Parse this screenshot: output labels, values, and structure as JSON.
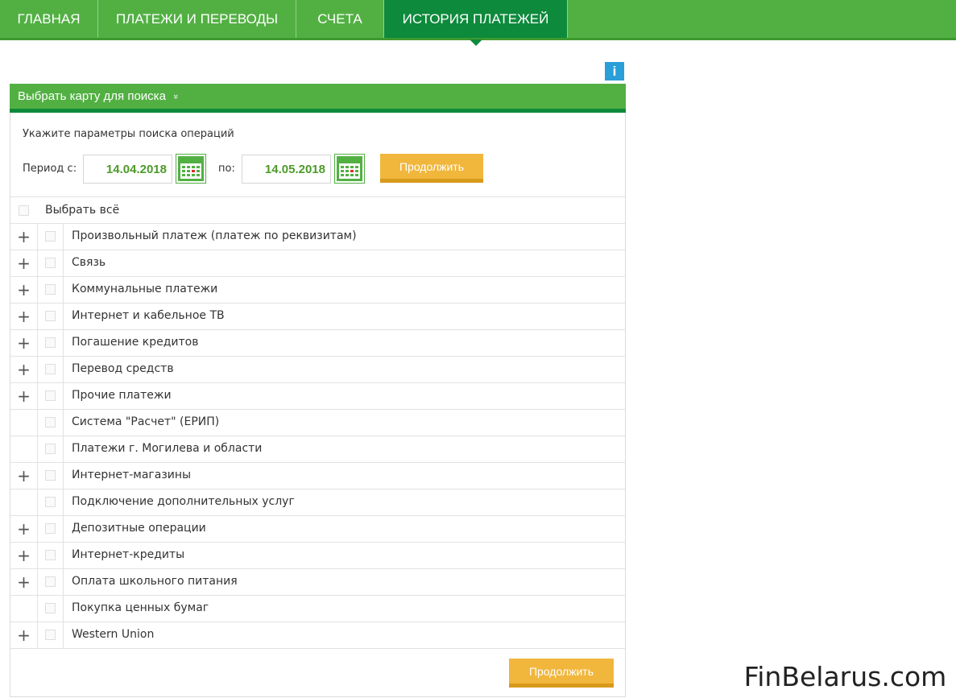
{
  "nav": {
    "tabs": [
      {
        "label": "ГЛАВНАЯ"
      },
      {
        "label": "ПЛАТЕЖИ И ПЕРЕВОДЫ"
      },
      {
        "label": "СЧЕТА"
      },
      {
        "label": "ИСТОРИЯ ПЛАТЕЖЕЙ",
        "active": true
      }
    ]
  },
  "info_label": "i",
  "card_select": {
    "label": "Выбрать карту для поиска",
    "chevron": "»"
  },
  "search": {
    "hint": "Укажите параметры поиска операций",
    "period_from_label": "Период с:",
    "date_from": "14.04.2018",
    "period_to_label": "по:",
    "date_to": "14.05.2018",
    "continue_label": "Продолжить"
  },
  "list": {
    "select_all_label": "Выбрать всё",
    "items": [
      {
        "label": "Произвольный платеж (платеж по реквизитам)",
        "expandable": true
      },
      {
        "label": "Связь",
        "expandable": true
      },
      {
        "label": "Коммунальные платежи",
        "expandable": true
      },
      {
        "label": "Интернет и кабельное ТВ",
        "expandable": true
      },
      {
        "label": "Погашение кредитов",
        "expandable": true
      },
      {
        "label": "Перевод средств",
        "expandable": true
      },
      {
        "label": "Прочие платежи",
        "expandable": true
      },
      {
        "label": "Система \"Расчет\" (ЕРИП)",
        "expandable": false
      },
      {
        "label": "Платежи г. Могилева и области",
        "expandable": false
      },
      {
        "label": "Интернет-магазины",
        "expandable": true
      },
      {
        "label": "Подключение дополнительных услуг",
        "expandable": false
      },
      {
        "label": "Депозитные операции",
        "expandable": true
      },
      {
        "label": "Интернет-кредиты",
        "expandable": true
      },
      {
        "label": "Оплата школьного питания",
        "expandable": true
      },
      {
        "label": "Покупка ценных бумаг",
        "expandable": false
      },
      {
        "label": "Western Union",
        "expandable": true
      }
    ],
    "plus_symbol": "+"
  },
  "bottom_continue_label": "Продолжить",
  "watermark": "FinBelarus.com",
  "colors": {
    "brand_green": "#52b043",
    "dark_green": "#0d8a3c",
    "button_orange": "#f1b63c",
    "info_blue": "#2a9fd8"
  }
}
